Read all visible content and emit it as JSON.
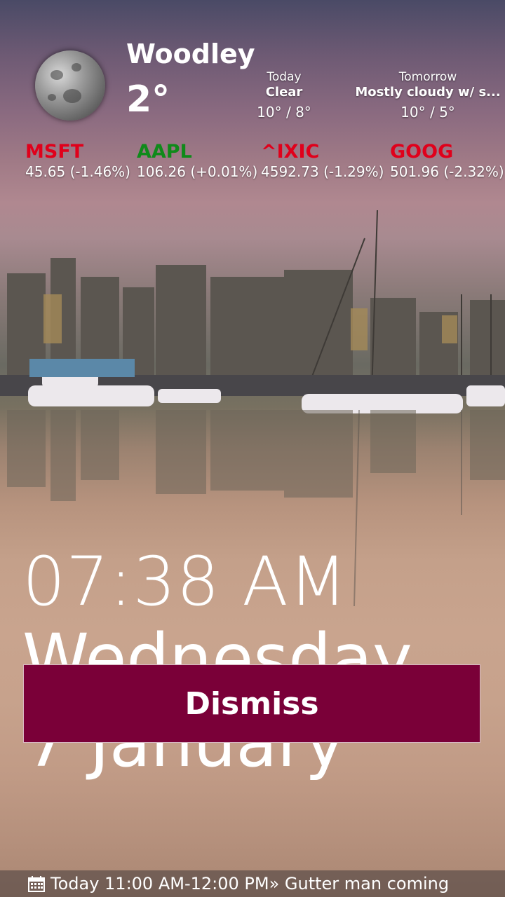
{
  "weather": {
    "city": "Woodley",
    "current_temp": "2°",
    "today": {
      "label": "Today",
      "condition": "Clear",
      "range": "10° / 8°"
    },
    "tomorrow": {
      "label": "Tomorrow",
      "condition": "Mostly cloudy w/ s...",
      "range": "10° / 5°"
    },
    "icon": "moon-icon"
  },
  "stocks": [
    {
      "symbol": "MSFT",
      "price": "45.65",
      "change": "(-1.46%)",
      "color": "#e0001b"
    },
    {
      "symbol": "AAPL",
      "price": "106.26",
      "change": "(+0.01%)",
      "color": "#0f8a1a"
    },
    {
      "symbol": "^IXIC",
      "price": "4592.73",
      "change": "(-1.29%)",
      "color": "#e0001b"
    },
    {
      "symbol": "GOOG",
      "price": "501.96",
      "change": "(-2.32%)",
      "color": "#e0001b"
    }
  ],
  "clock": {
    "time": "07:38 AM",
    "weekday": "Wednesday",
    "date": "7 January"
  },
  "alarm": {
    "dismiss_label": "Dismiss",
    "accent": "#7a0038"
  },
  "calendar": {
    "icon": "calendar-icon",
    "event": "Today 11:00 AM-12:00 PM» Gutter man coming"
  }
}
